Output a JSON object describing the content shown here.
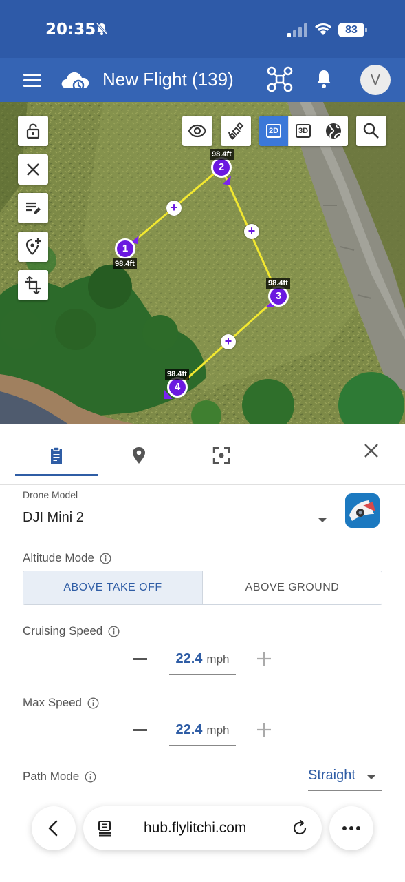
{
  "status_bar": {
    "time": "20:35",
    "battery": "83"
  },
  "header": {
    "title": "New Flight (139)",
    "avatar_initial": "V"
  },
  "map": {
    "view_modes": [
      "2D",
      "3D"
    ],
    "active_view": "2D",
    "waypoints": [
      {
        "number": "1",
        "altitude": "98.4ft"
      },
      {
        "number": "2",
        "altitude": "98.4ft"
      },
      {
        "number": "3",
        "altitude": "98.4ft"
      },
      {
        "number": "4",
        "altitude": "98.4ft"
      }
    ],
    "add_waypoint_symbol": "+"
  },
  "panel": {
    "drone_model": {
      "caption": "Drone Model",
      "value": "DJI Mini 2"
    },
    "altitude_mode": {
      "label": "Altitude Mode",
      "options": [
        "ABOVE TAKE OFF",
        "ABOVE GROUND"
      ],
      "selected": "ABOVE TAKE OFF"
    },
    "cruising_speed": {
      "label": "Cruising Speed",
      "value": "22.4",
      "unit": "mph"
    },
    "max_speed": {
      "label": "Max Speed",
      "value": "22.4",
      "unit": "mph"
    },
    "path_mode": {
      "label": "Path Mode",
      "value": "Straight"
    }
  },
  "browser": {
    "url": "hub.flylitchi.com"
  },
  "colors": {
    "header": "#3564b4",
    "accent": "#2f5da5",
    "waypoint": "#6a18e0",
    "path": "#f2e830"
  },
  "icons": [
    "menu-icon",
    "cloud-icon",
    "drone-icon",
    "bell-icon",
    "lock-icon",
    "close-icon",
    "edit-list-icon",
    "add-location-icon",
    "crop-rotate-icon",
    "eye-icon",
    "satellite-icon",
    "globe-icon",
    "search-icon",
    "clipboard-icon",
    "location-pin-icon",
    "focus-icon",
    "info-icon",
    "back-chevron-icon",
    "reader-icon",
    "reload-icon",
    "more-icon"
  ]
}
